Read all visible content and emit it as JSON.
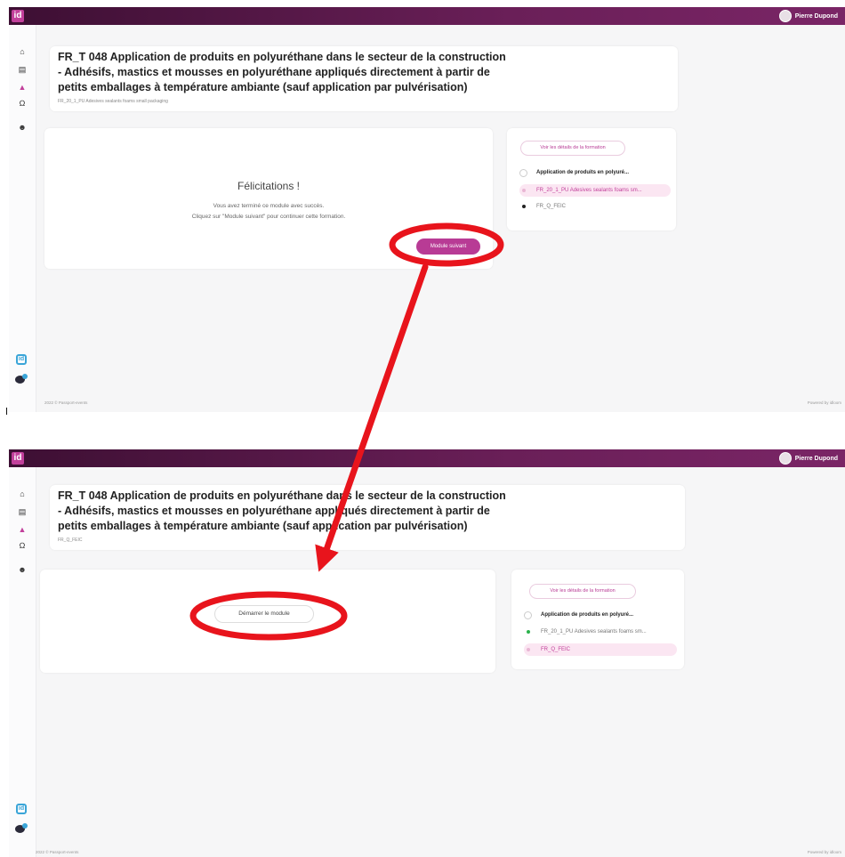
{
  "app": {
    "logo_text": "id",
    "user_name": "Pierre Dupond",
    "brand_color": "#6a1f58",
    "accent_color": "#c2409b"
  },
  "sidebar": {
    "icons": [
      "home-icon",
      "document-icon",
      "training-icon",
      "award-icon",
      "users-icon"
    ],
    "bottom_logo_text": "id",
    "chat_badge": "1"
  },
  "course": {
    "title_line1": "FR_T 048 Application de produits en polyuréthane dans le secteur de la construction",
    "title_line2": "- Adhésifs, mastics et mousses en polyuréthane appliqués directement à partir de",
    "title_line3": "petits emballages à température ambiante (sauf application par pulvérisation)"
  },
  "screen_top": {
    "module_code": "FR_20_1_PU Adesives sealants foams small packaging",
    "congrats_title": "Félicitations !",
    "message_line1": "Vous avez terminé ce module avec succès.",
    "message_line2": "Cliquez sur \"Module suivant\" pour continuer cette formation.",
    "next_button": "Module suivant",
    "details_button": "Voir les détails de la formation",
    "modules": [
      {
        "label": "Application de produits en polyuré...",
        "state": "parent"
      },
      {
        "label": "FR_20_1_PU Adesives sealants foams sm...",
        "state": "current"
      },
      {
        "label": "FR_Q_FEIC",
        "state": "todo"
      }
    ],
    "footer_left": "2022 © Passport-events",
    "footer_right": "Powered by idloom"
  },
  "screen_bottom": {
    "module_code": "FR_Q_FEIC",
    "start_button": "Démarrer le module",
    "details_button": "Voir les détails de la formation",
    "modules": [
      {
        "label": "Application de produits en polyuré...",
        "state": "parent"
      },
      {
        "label": "FR_20_1_PU Adesives sealants foams sm...",
        "state": "done"
      },
      {
        "label": "FR_Q_FEIC",
        "state": "current"
      }
    ],
    "footer_left": "2022 © Passport-events",
    "footer_right": "Powered by idloom"
  },
  "annotation": {
    "color": "#e8141c"
  }
}
